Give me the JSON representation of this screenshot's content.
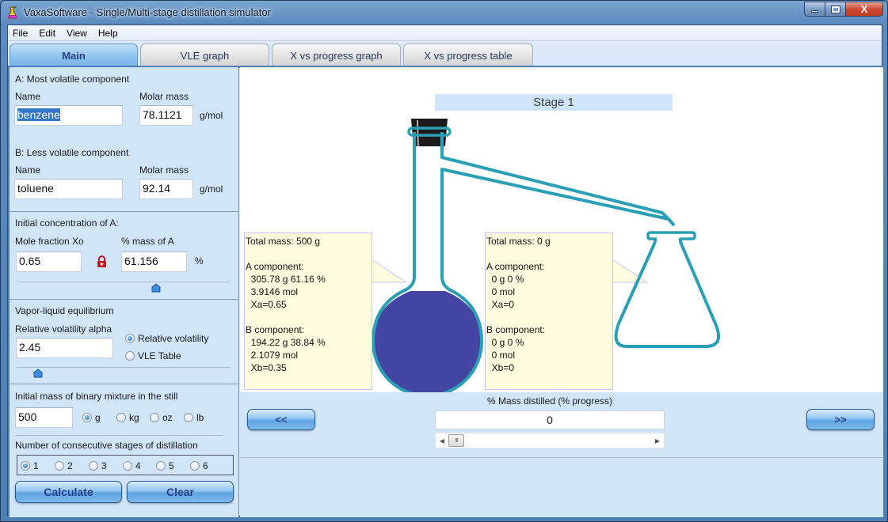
{
  "window": {
    "title": "VaxaSoftware - Single/Multi-stage distillation simulator",
    "controls": {
      "minimize": "—",
      "maximize": "□",
      "close": "X"
    }
  },
  "menu": [
    "File",
    "Edit",
    "View",
    "Help"
  ],
  "tabs": [
    {
      "label": "Main",
      "active": true
    },
    {
      "label": "VLE graph",
      "active": false
    },
    {
      "label": "X vs progress graph",
      "active": false
    },
    {
      "label": "X vs progress table",
      "active": false
    }
  ],
  "left_panel": {
    "component_a": {
      "heading": "A: Most volatile component",
      "name_label": "Name",
      "name_value": "benzene",
      "molar_label": "Molar mass",
      "molar_value": "78.1121",
      "unit": "g/mol"
    },
    "component_b": {
      "heading": "B: Less volatile component",
      "name_label": "Name",
      "name_value": "toluene",
      "molar_label": "Molar mass",
      "molar_value": "92.14",
      "unit": "g/mol"
    },
    "concentration": {
      "heading": "Initial concentration of A:",
      "mole_fraction_label": "Mole fraction Xo",
      "mole_fraction_value": "0.65",
      "mass_label": "% mass of A",
      "mass_value": "61.156",
      "mass_unit": "%",
      "slider_value": 0.65,
      "lock_color": "#cc1020"
    },
    "vle": {
      "heading": "Vapor-liquid equilibrium",
      "alpha_label": "Relative volatility alpha",
      "alpha_value": "2.45",
      "options": [
        {
          "label": "Relative volatility",
          "selected": true
        },
        {
          "label": "VLE Table",
          "selected": false
        }
      ],
      "slider_value": 0.1
    },
    "mass": {
      "heading": "Initial mass of binary mixture in the still",
      "value": "500",
      "units": [
        {
          "label": "g",
          "selected": true
        },
        {
          "label": "kg",
          "selected": false
        },
        {
          "label": "oz",
          "selected": false
        },
        {
          "label": "lb",
          "selected": false
        }
      ]
    },
    "stages": {
      "heading": "Number of consecutive stages of distillation",
      "options": [
        {
          "label": "1",
          "selected": true
        },
        {
          "label": "2",
          "selected": false
        },
        {
          "label": "3",
          "selected": false
        },
        {
          "label": "4",
          "selected": false
        },
        {
          "label": "5",
          "selected": false
        },
        {
          "label": "6",
          "selected": false
        }
      ]
    },
    "buttons": {
      "calculate": "Calculate",
      "clear": "Clear"
    }
  },
  "stage": {
    "title": "Stage 1",
    "liquid_color": "#4446a3",
    "glass_color": "#2a9fb5",
    "still": {
      "lines": [
        "Total mass: 500 g",
        "",
        "A component:",
        "  305.78 g 61.16 %",
        "  3.9146 mol",
        "  Xa=0.65",
        "",
        "B component:",
        "  194.22 g 38.84 %",
        "  2.1079 mol",
        "  Xb=0.35"
      ]
    },
    "receiver": {
      "lines": [
        "Total mass: 0 g",
        "",
        "A component:",
        "  0 g 0 %",
        "  0 mol",
        "  Xa=0",
        "",
        "B component:",
        "  0 g 0 %",
        "  0 mol",
        "  Xb=0"
      ]
    }
  },
  "progress": {
    "label": "% Mass distilled (% progress)",
    "value": "0",
    "scroll_fraction": 0,
    "prev_label": "<<",
    "next_label": ">>"
  }
}
